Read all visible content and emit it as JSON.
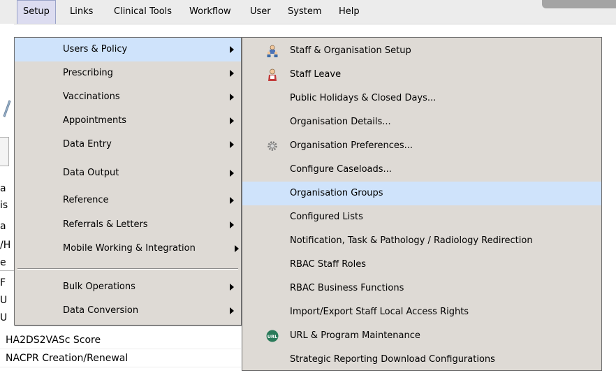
{
  "menubar": {
    "items": [
      {
        "label": "Setup"
      },
      {
        "label": "Links"
      },
      {
        "label": "Clinical Tools"
      },
      {
        "label": "Workflow"
      },
      {
        "label": "User"
      },
      {
        "label": "System"
      },
      {
        "label": "Help"
      }
    ],
    "active": "Setup"
  },
  "background_app": {
    "fragments": [
      "a",
      "is",
      "a",
      "/H",
      "e",
      "F",
      "U",
      "U"
    ],
    "rows": [
      {
        "label": "HA2DS2VASc Score"
      },
      {
        "label": "NACPR Creation/Renewal"
      }
    ]
  },
  "setup_menu": {
    "items": [
      {
        "label": "Users & Policy",
        "has_submenu": true,
        "highlighted": true
      },
      {
        "label": "Prescribing",
        "has_submenu": true
      },
      {
        "label": "Vaccinations",
        "has_submenu": true
      },
      {
        "label": "Appointments",
        "has_submenu": true
      },
      {
        "label": "Data Entry",
        "has_submenu": true
      },
      {
        "label": "Data Output",
        "has_submenu": true
      },
      {
        "label": "Reference",
        "has_submenu": true
      },
      {
        "label": "Referrals & Letters",
        "has_submenu": true
      },
      {
        "label": "Mobile Working & Integration",
        "has_submenu": true
      },
      {
        "label": "Bulk Operations",
        "has_submenu": true
      },
      {
        "label": "Data Conversion",
        "has_submenu": true
      }
    ]
  },
  "users_policy_submenu": {
    "items": [
      {
        "label": "Staff & Organisation Setup",
        "icon": "staff-group-icon"
      },
      {
        "label": "Staff Leave",
        "icon": "staff-leave-icon"
      },
      {
        "label": "Public Holidays & Closed Days..."
      },
      {
        "label": "Organisation Details..."
      },
      {
        "label": "Organisation Preferences...",
        "icon": "gear-icon"
      },
      {
        "label": "Configure Caseloads..."
      },
      {
        "label": "Organisation Groups",
        "highlighted": true
      },
      {
        "label": "Configured Lists"
      },
      {
        "label": "Notification, Task & Pathology / Radiology Redirection"
      },
      {
        "label": "RBAC Staff Roles"
      },
      {
        "label": "RBAC Business Functions"
      },
      {
        "label": "Import/Export Staff Local Access Rights"
      },
      {
        "label": "URL & Program Maintenance",
        "icon": "url-icon"
      },
      {
        "label": "Strategic Reporting Download Configurations"
      }
    ]
  },
  "colors": {
    "menu_bg": "#dedad5",
    "highlight": "#cfe3fb",
    "menubar_bg": "#ececec"
  }
}
